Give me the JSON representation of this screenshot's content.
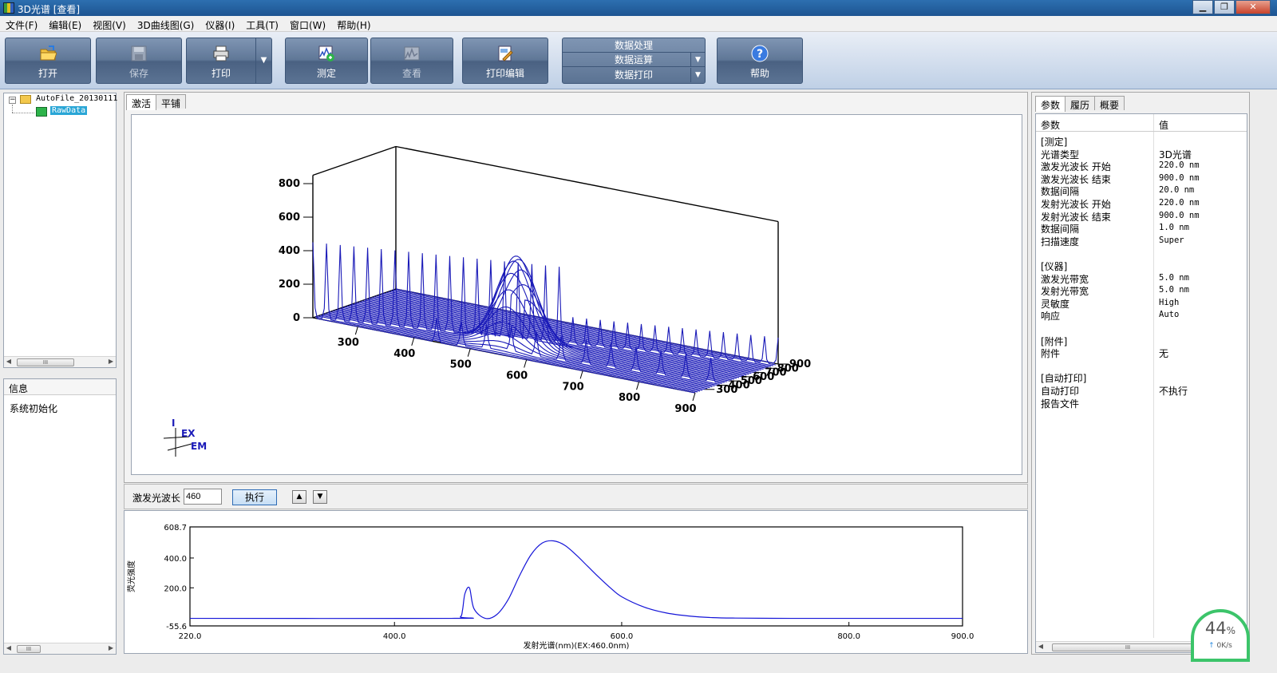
{
  "window": {
    "title": "3D光谱 [查看]"
  },
  "menu": [
    "文件(F)",
    "编辑(E)",
    "视图(V)",
    "3D曲线图(G)",
    "仪器(I)",
    "工具(T)",
    "窗口(W)",
    "帮助(H)"
  ],
  "toolbar": {
    "open": "打开",
    "save": "保存",
    "print": "打印",
    "measure": "测定",
    "view": "查看",
    "print_edit": "打印编辑",
    "help": "帮助",
    "data_processing": "数据处理",
    "data_operation": "数据运算",
    "data_print": "数据打印"
  },
  "tree": {
    "root": "AutoFile_20130111",
    "child": "RawData"
  },
  "info": {
    "header": "信息",
    "message": "系统初始化"
  },
  "center_tabs": [
    "激活",
    "平铺"
  ],
  "plot3d": {
    "y_ticks": [
      "0",
      "200",
      "400",
      "600",
      "800"
    ],
    "em_ticks": [
      "300",
      "400",
      "500",
      "600",
      "700",
      "800",
      "900"
    ],
    "ex_ticks": [
      "300",
      "400",
      "500",
      "600",
      "700",
      "800",
      "900"
    ],
    "axis_i": "I",
    "axis_ex": "EX",
    "axis_em": "EM"
  },
  "excitation": {
    "label": "激发光波长",
    "value": "460",
    "execute": "执行"
  },
  "chart_data": {
    "type": "line",
    "xlabel": "发射光谱(nm)(EX:460.0nm)",
    "ylabel": "荧光强度",
    "xlim": [
      220,
      900
    ],
    "ylim": [
      -55.6,
      608.7
    ],
    "x_ticks": [
      "220.0",
      "400.0",
      "600.0",
      "800.0",
      "900.0"
    ],
    "y_ticks": [
      "608.7",
      "400.0",
      "200.0",
      "-55.6"
    ],
    "series": [
      {
        "color": "#1515d8",
        "x": [
          220,
          450,
          458,
          460,
          462,
          466,
          470,
          480,
          490,
          500,
          510,
          520,
          530,
          540,
          550,
          560,
          570,
          580,
          590,
          600,
          620,
          640,
          660,
          680,
          700,
          750,
          800,
          900
        ],
        "y": [
          -5,
          -5,
          5,
          55,
          160,
          200,
          60,
          -5,
          20,
          120,
          280,
          420,
          500,
          515,
          485,
          420,
          345,
          270,
          200,
          140,
          70,
          30,
          10,
          0,
          -3,
          -5,
          -5,
          -5
        ]
      }
    ]
  },
  "right_panel": {
    "tabs": [
      "参数",
      "履历",
      "概要"
    ],
    "header": {
      "param": "参数",
      "value": "值"
    },
    "rows": [
      {
        "k": "[测定]",
        "v": ""
      },
      {
        "k": "光谱类型",
        "v": "3D光谱"
      },
      {
        "k": "激发光波长 开始",
        "v": "220.0 nm"
      },
      {
        "k": "激发光波长 结束",
        "v": "900.0 nm"
      },
      {
        "k": "数据间隔",
        "v": "20.0 nm"
      },
      {
        "k": "发射光波长 开始",
        "v": "220.0 nm"
      },
      {
        "k": "发射光波长 结束",
        "v": "900.0 nm"
      },
      {
        "k": "数据间隔",
        "v": "1.0 nm"
      },
      {
        "k": "扫描速度",
        "v": "Super"
      },
      {
        "k": "",
        "v": ""
      },
      {
        "k": "[仪器]",
        "v": ""
      },
      {
        "k": "激发光带宽",
        "v": "5.0 nm"
      },
      {
        "k": "发射光带宽",
        "v": "5.0 nm"
      },
      {
        "k": "灵敏度",
        "v": "High"
      },
      {
        "k": "响应",
        "v": "Auto"
      },
      {
        "k": "",
        "v": ""
      },
      {
        "k": "[附件]",
        "v": ""
      },
      {
        "k": "附件",
        "v": "无"
      },
      {
        "k": "",
        "v": ""
      },
      {
        "k": "[自动打印]",
        "v": ""
      },
      {
        "k": "自动打印",
        "v": "不执行"
      },
      {
        "k": "报告文件",
        "v": ""
      }
    ]
  },
  "net_widget": {
    "percent": "44",
    "unit": "%",
    "speed": "0K/s"
  }
}
